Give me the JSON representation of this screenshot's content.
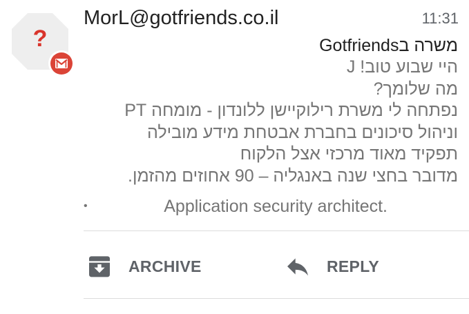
{
  "email": {
    "sender": "MorL@gotfriends.co.il",
    "time": "11:31",
    "subject": "משרה בGotfriends",
    "snippet_lines": [
      "היי שבוע טוב! J",
      "מה שלומך?",
      "נפתחה לי משרת רילוקיישן ללונדון - מומחה PT",
      "וניהול סיכונים בחברת אבטחת מידע מובילה",
      "תפקיד מאוד מרכזי אצל הלקוח",
      "מדובר בחצי שנה באנגליה – 90 אחוזים מהזמן."
    ],
    "bullet_symbol": "•",
    "bullet_text": "Application security architect."
  },
  "avatar": {
    "glyph": "?",
    "icon": "unknown-contact-icon",
    "badge_icon": "gmail-icon"
  },
  "actions": {
    "archive_label": "ARCHIVE",
    "archive_icon": "archive-icon",
    "reply_label": "REPLY",
    "reply_icon": "reply-icon"
  },
  "colors": {
    "avatar_bg": "#eeeeee",
    "avatar_glyph": "#d9342b",
    "gmail_badge": "#db4437",
    "primary_text": "#212121",
    "secondary_text": "#757575",
    "action_gray": "#5f6368"
  }
}
